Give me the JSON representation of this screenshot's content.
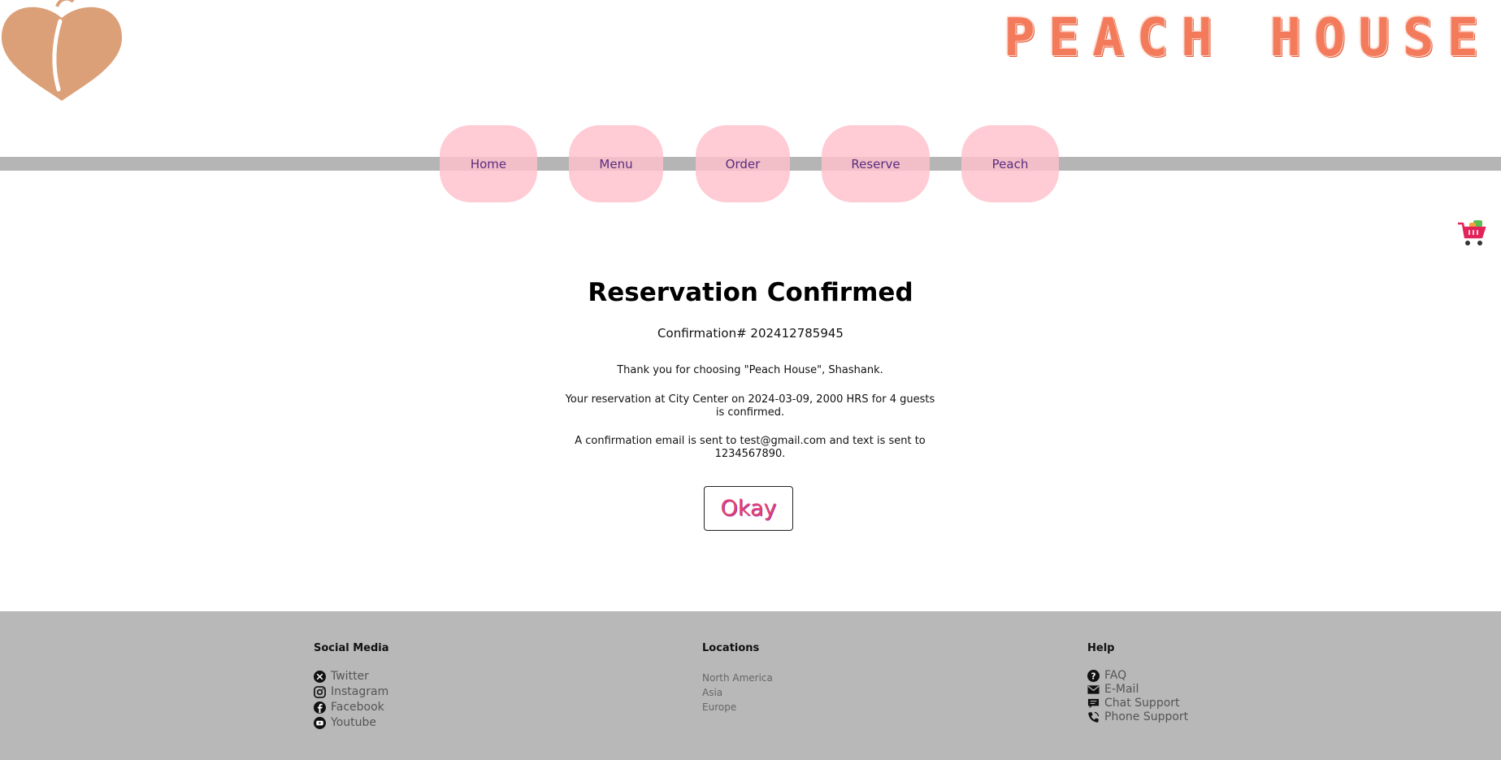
{
  "brand": {
    "name": "PEACH HOUSE"
  },
  "nav": [
    {
      "label": "Home"
    },
    {
      "label": "Menu"
    },
    {
      "label": "Order"
    },
    {
      "label": "Reserve"
    },
    {
      "label": "Peach"
    }
  ],
  "main": {
    "title": "Reservation Confirmed",
    "confirmation": "Confirmation# 202412785945",
    "thanks": "Thank you for choosing \"Peach House\", Shashank.",
    "details": "Your reservation at City Center on 2024-03-09, 2000 HRS for 4 guests is confirmed.",
    "notice": "A confirmation email is sent to test@gmail.com and text is sent to 1234567890.",
    "okay_label": "Okay"
  },
  "footer": {
    "social": {
      "heading": "Social Media",
      "items": [
        {
          "label": "Twitter",
          "icon": "x-icon"
        },
        {
          "label": "Instagram",
          "icon": "instagram-icon"
        },
        {
          "label": "Facebook",
          "icon": "facebook-icon"
        },
        {
          "label": "Youtube",
          "icon": "youtube-icon"
        }
      ]
    },
    "locations": {
      "heading": "Locations",
      "items": [
        "North America",
        "Asia",
        "Europe"
      ]
    },
    "help": {
      "heading": "Help",
      "items": [
        {
          "label": "FAQ",
          "icon": "question-icon"
        },
        {
          "label": "E-Mail",
          "icon": "envelope-icon"
        },
        {
          "label": "Chat Support",
          "icon": "chat-icon"
        },
        {
          "label": "Phone Support",
          "icon": "phone-icon"
        }
      ]
    }
  },
  "colors": {
    "peach": "#dca078",
    "brand_text": "#f37b5b",
    "nav_pill": "#ffc0cc",
    "nav_text": "#5a2c80",
    "bar_gray": "#b5b5b5",
    "okay_text": "#e8426b"
  }
}
